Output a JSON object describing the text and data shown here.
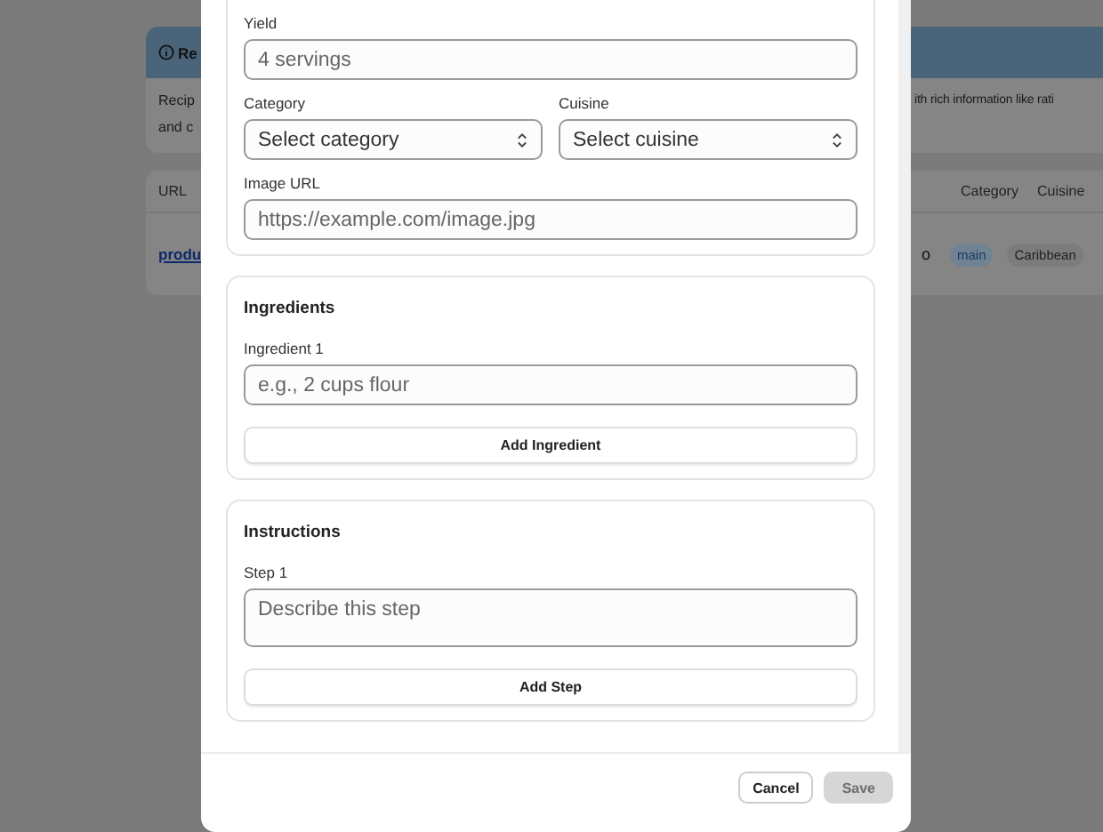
{
  "background": {
    "banner": {
      "title": "Re",
      "text_left": [
        "Recip",
        "and c"
      ],
      "text_right": "ith rich information like rati"
    },
    "table": {
      "columns_left": [
        "URL"
      ],
      "columns_right": [
        "Category",
        "Cuisine"
      ],
      "row": {
        "url": "produ",
        "fragment": "o",
        "category": "main",
        "cuisine": "Caribbean"
      }
    }
  },
  "modal": {
    "sections": [
      {
        "rows": [
          [
            {
              "label": "Yield",
              "kind": "input",
              "placeholder": "4 servings"
            }
          ],
          [
            {
              "label": "Category",
              "kind": "select",
              "value": "Select category"
            },
            {
              "label": "Cuisine",
              "kind": "select",
              "value": "Select cuisine"
            }
          ],
          [
            {
              "label": "Image URL",
              "kind": "input",
              "placeholder": "https://example.com/image.jpg"
            }
          ]
        ]
      },
      {
        "title": "Ingredients",
        "rows": [
          [
            {
              "label": "Ingredient 1",
              "kind": "input",
              "placeholder": "e.g., 2 cups flour"
            }
          ]
        ],
        "add_button": "Add Ingredient"
      },
      {
        "title": "Instructions",
        "rows": [
          [
            {
              "label": "Step 1",
              "kind": "textarea",
              "placeholder": "Describe this step"
            }
          ]
        ],
        "add_button": "Add Step"
      }
    ],
    "buttons": [
      {
        "label": "Cancel",
        "disabled": false
      },
      {
        "label": "Save",
        "disabled": true
      }
    ]
  }
}
